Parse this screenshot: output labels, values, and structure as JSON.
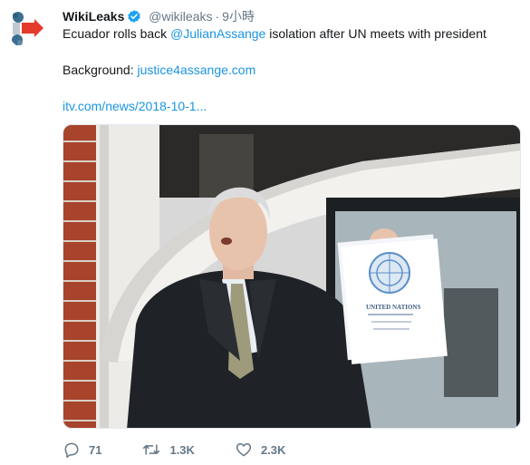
{
  "tweet": {
    "author_name": "WikiLeaks",
    "handle": "@wikileaks",
    "separator": "·",
    "time": "9小時",
    "text_before": "Ecuador rolls back ",
    "mention": "@JulianAssange",
    "text_after": " isolation after UN meets with president",
    "background_label": "Background: ",
    "background_link": "justice4assange.com",
    "source_link": "itv.com/news/2018-10-1...",
    "image": {
      "paper_title": "UNITED NATIONS"
    }
  },
  "actions": {
    "replies": "71",
    "retweets": "1.3K",
    "likes": "2.3K"
  },
  "colors": {
    "link": "#1b95e0",
    "verified": "#1da1f2",
    "muted": "#657786"
  }
}
